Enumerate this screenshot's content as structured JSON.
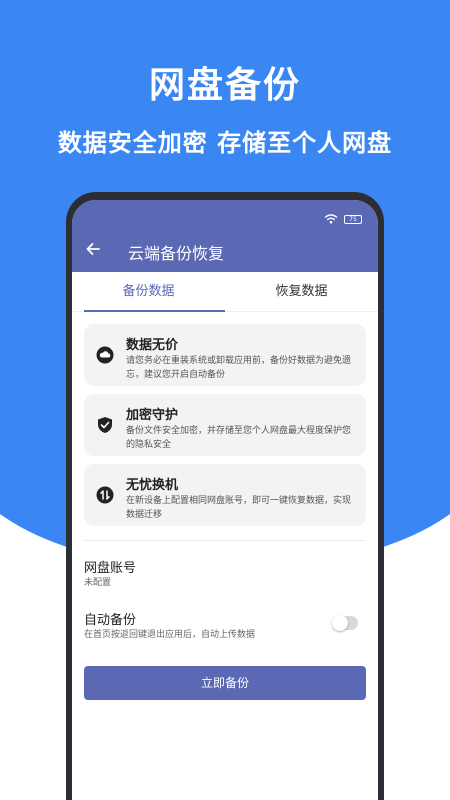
{
  "promo": {
    "title": "网盘备份",
    "subtitle": "数据安全加密 存储至个人网盘"
  },
  "colors": {
    "background_blue": "#3a86f3",
    "accent": "#5b68b3",
    "phone_frame": "#2d2e33"
  },
  "status_bar": {
    "battery": "75"
  },
  "appbar": {
    "back_icon": "arrow-left-icon",
    "title": "云端备份恢复"
  },
  "tabs": [
    {
      "label": "备份数据",
      "active": true
    },
    {
      "label": "恢复数据",
      "active": false
    }
  ],
  "cards": [
    {
      "icon": "cloud-icon",
      "title": "数据无价",
      "desc": "请您务必在重装系统或卸载应用前，备份好数据为避免遗忘，建议您开启自动备份"
    },
    {
      "icon": "shield-check-icon",
      "title": "加密守护",
      "desc": "备份文件安全加密，并存储至您个人网盘最大程度保护您的隐私安全"
    },
    {
      "icon": "sync-icon",
      "title": "无忧换机",
      "desc": "在新设备上配置相同网盘账号，即可一键恢复数据，实现数据迁移"
    }
  ],
  "account": {
    "title": "网盘账号",
    "value": "未配置"
  },
  "auto_backup": {
    "title": "自动备份",
    "desc": "在首页按返回键退出应用后，自动上传数据",
    "enabled": false
  },
  "primary_button": {
    "label": "立即备份"
  }
}
